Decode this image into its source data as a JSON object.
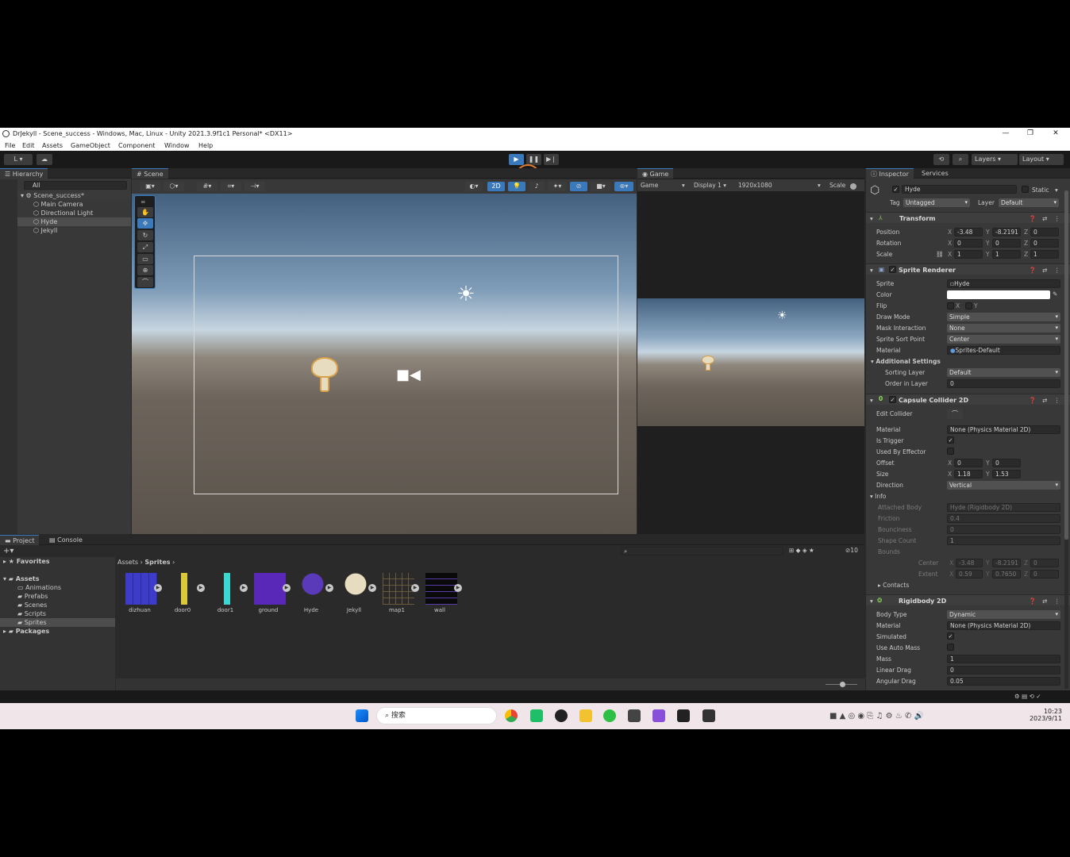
{
  "window": {
    "title": "DrJekyll - Scene_success - Windows, Mac, Linux - Unity 2021.3.9f1c1 Personal* <DX11>",
    "minimize": "—",
    "maximize": "❐",
    "close": "✕"
  },
  "menu": [
    "File",
    "Edit",
    "Assets",
    "GameObject",
    "Component",
    "Window",
    "Help"
  ],
  "toolbar": {
    "account": "L ▾",
    "layers": "Layers",
    "layout": "Layout"
  },
  "hierarchy": {
    "tab": "Hierarchy",
    "search_placeholder": "All",
    "scene": "Scene_success*",
    "items": [
      "Main Camera",
      "Directional Light",
      "Hyde",
      "Jekyll"
    ]
  },
  "scene": {
    "tab": "Scene",
    "mode_2d": "2D"
  },
  "game": {
    "tab": "Game",
    "view": "Game",
    "display": "Display 1",
    "resolution": "1920x1080",
    "scale": "Scale"
  },
  "inspector": {
    "tab": "Inspector",
    "services_tab": "Services",
    "object_name": "Hyde",
    "static": "Static",
    "tag_label": "Tag",
    "tag": "Untagged",
    "layer_label": "Layer",
    "layer": "Default",
    "transform": {
      "title": "Transform",
      "position_label": "Position",
      "rotation_label": "Rotation",
      "scale_label": "Scale",
      "position": [
        "-3.48",
        "-8.2191",
        "0"
      ],
      "rotation": [
        "0",
        "0",
        "0"
      ],
      "scale": [
        "1",
        "1",
        "1"
      ]
    },
    "sprite_renderer": {
      "title": "Sprite Renderer",
      "sprite_label": "Sprite",
      "sprite": "Hyde",
      "color_label": "Color",
      "flip_label": "Flip",
      "flip_x": "X",
      "flip_y": "Y",
      "draw_mode_label": "Draw Mode",
      "draw_mode": "Simple",
      "mask_label": "Mask Interaction",
      "mask": "None",
      "sort_point_label": "Sprite Sort Point",
      "sort_point": "Center",
      "material_label": "Material",
      "material": "Sprites-Default",
      "additional": "Additional Settings",
      "sorting_layer_label": "Sorting Layer",
      "sorting_layer": "Default",
      "order_label": "Order in Layer",
      "order": "0"
    },
    "capsule": {
      "title": "Capsule Collider 2D",
      "edit_label": "Edit Collider",
      "material_label": "Material",
      "material": "None (Physics Material 2D)",
      "trigger_label": "Is Trigger",
      "effector_label": "Used By Effector",
      "offset_label": "Offset",
      "offset": [
        "0",
        "0"
      ],
      "size_label": "Size",
      "size": [
        "1.18",
        "1.53"
      ],
      "direction_label": "Direction",
      "direction": "Vertical",
      "info": "Info",
      "attached_label": "Attached Body",
      "attached": "Hyde (Rigidbody 2D)",
      "friction_label": "Friction",
      "friction": "0.4",
      "bounciness_label": "Bounciness",
      "bounciness": "0",
      "shape_label": "Shape Count",
      "shape": "1",
      "bounds_label": "Bounds",
      "center_label": "Center",
      "center": [
        "-3.48",
        "-8.2191",
        "0"
      ],
      "extent_label": "Extent",
      "extent": [
        "0.59",
        "0.7650",
        "0"
      ],
      "contacts": "Contacts"
    },
    "rigidbody": {
      "title": "Rigidbody 2D",
      "body_type_label": "Body Type",
      "body_type": "Dynamic",
      "material_label": "Material",
      "material": "None (Physics Material 2D)",
      "simulated_label": "Simulated",
      "auto_mass_label": "Use Auto Mass",
      "mass_label": "Mass",
      "mass": "1",
      "linear_label": "Linear Drag",
      "linear": "0",
      "angular_label": "Angular Drag",
      "angular": "0.05"
    }
  },
  "project": {
    "tab": "Project",
    "console_tab": "Console",
    "favorites": "Favorites",
    "assets": "Assets",
    "folders": [
      "Animations",
      "Prefabs",
      "Scenes",
      "Scripts",
      "Sprites"
    ],
    "packages": "Packages",
    "breadcrumb": [
      "Assets",
      "Sprites"
    ],
    "hidden_count": "10",
    "items": [
      "dizhuan",
      "door0",
      "door1",
      "ground",
      "Hyde",
      "Jekyll",
      "map1",
      "wall"
    ]
  },
  "taskbar": {
    "search": "搜索",
    "time": "10:23",
    "date": "2023/9/11"
  },
  "colors": {
    "accent": "#3a79bb",
    "panel": "#383838",
    "dark": "#191919"
  }
}
